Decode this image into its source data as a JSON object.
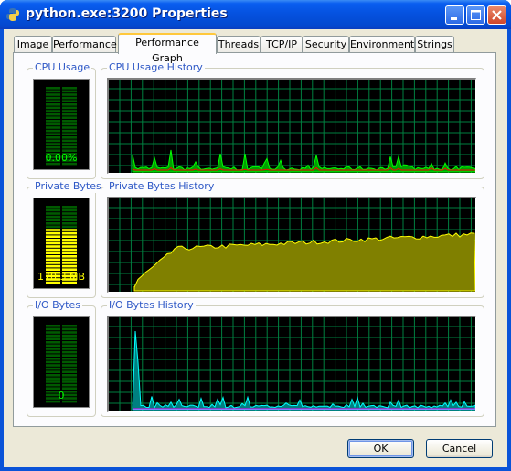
{
  "window": {
    "title": "python.exe:3200 Properties"
  },
  "tabs": [
    {
      "label": "Image"
    },
    {
      "label": "Performance"
    },
    {
      "label": "Performance Graph",
      "active": true
    },
    {
      "label": "Threads"
    },
    {
      "label": "TCP/IP"
    },
    {
      "label": "Security"
    },
    {
      "label": "Environment"
    },
    {
      "label": "Strings"
    }
  ],
  "sections": {
    "cpu": {
      "meter_label": "CPU Usage",
      "value": "0.00%",
      "history_label": "CPU Usage History",
      "meter_fill": 0.0
    },
    "private": {
      "meter_label": "Private Bytes",
      "value": "170.3 MB",
      "history_label": "Private Bytes History",
      "meter_fill": 0.72
    },
    "io": {
      "meter_label": "I/O Bytes",
      "value": "0",
      "history_label": "I/O Bytes History",
      "meter_fill": 0.0
    }
  },
  "buttons": {
    "ok": "OK",
    "cancel": "Cancel"
  },
  "colors": {
    "grid": "#008040",
    "cpu_line": "#00ff00",
    "cpu_kernel": "#ff0000",
    "private_fill": "#808000",
    "private_line": "#ffff00",
    "io_line": "#00ffff",
    "io_write": "#ff00ff",
    "meter_text_green": "#00ff00",
    "meter_text_yellow": "#ffff00"
  }
}
